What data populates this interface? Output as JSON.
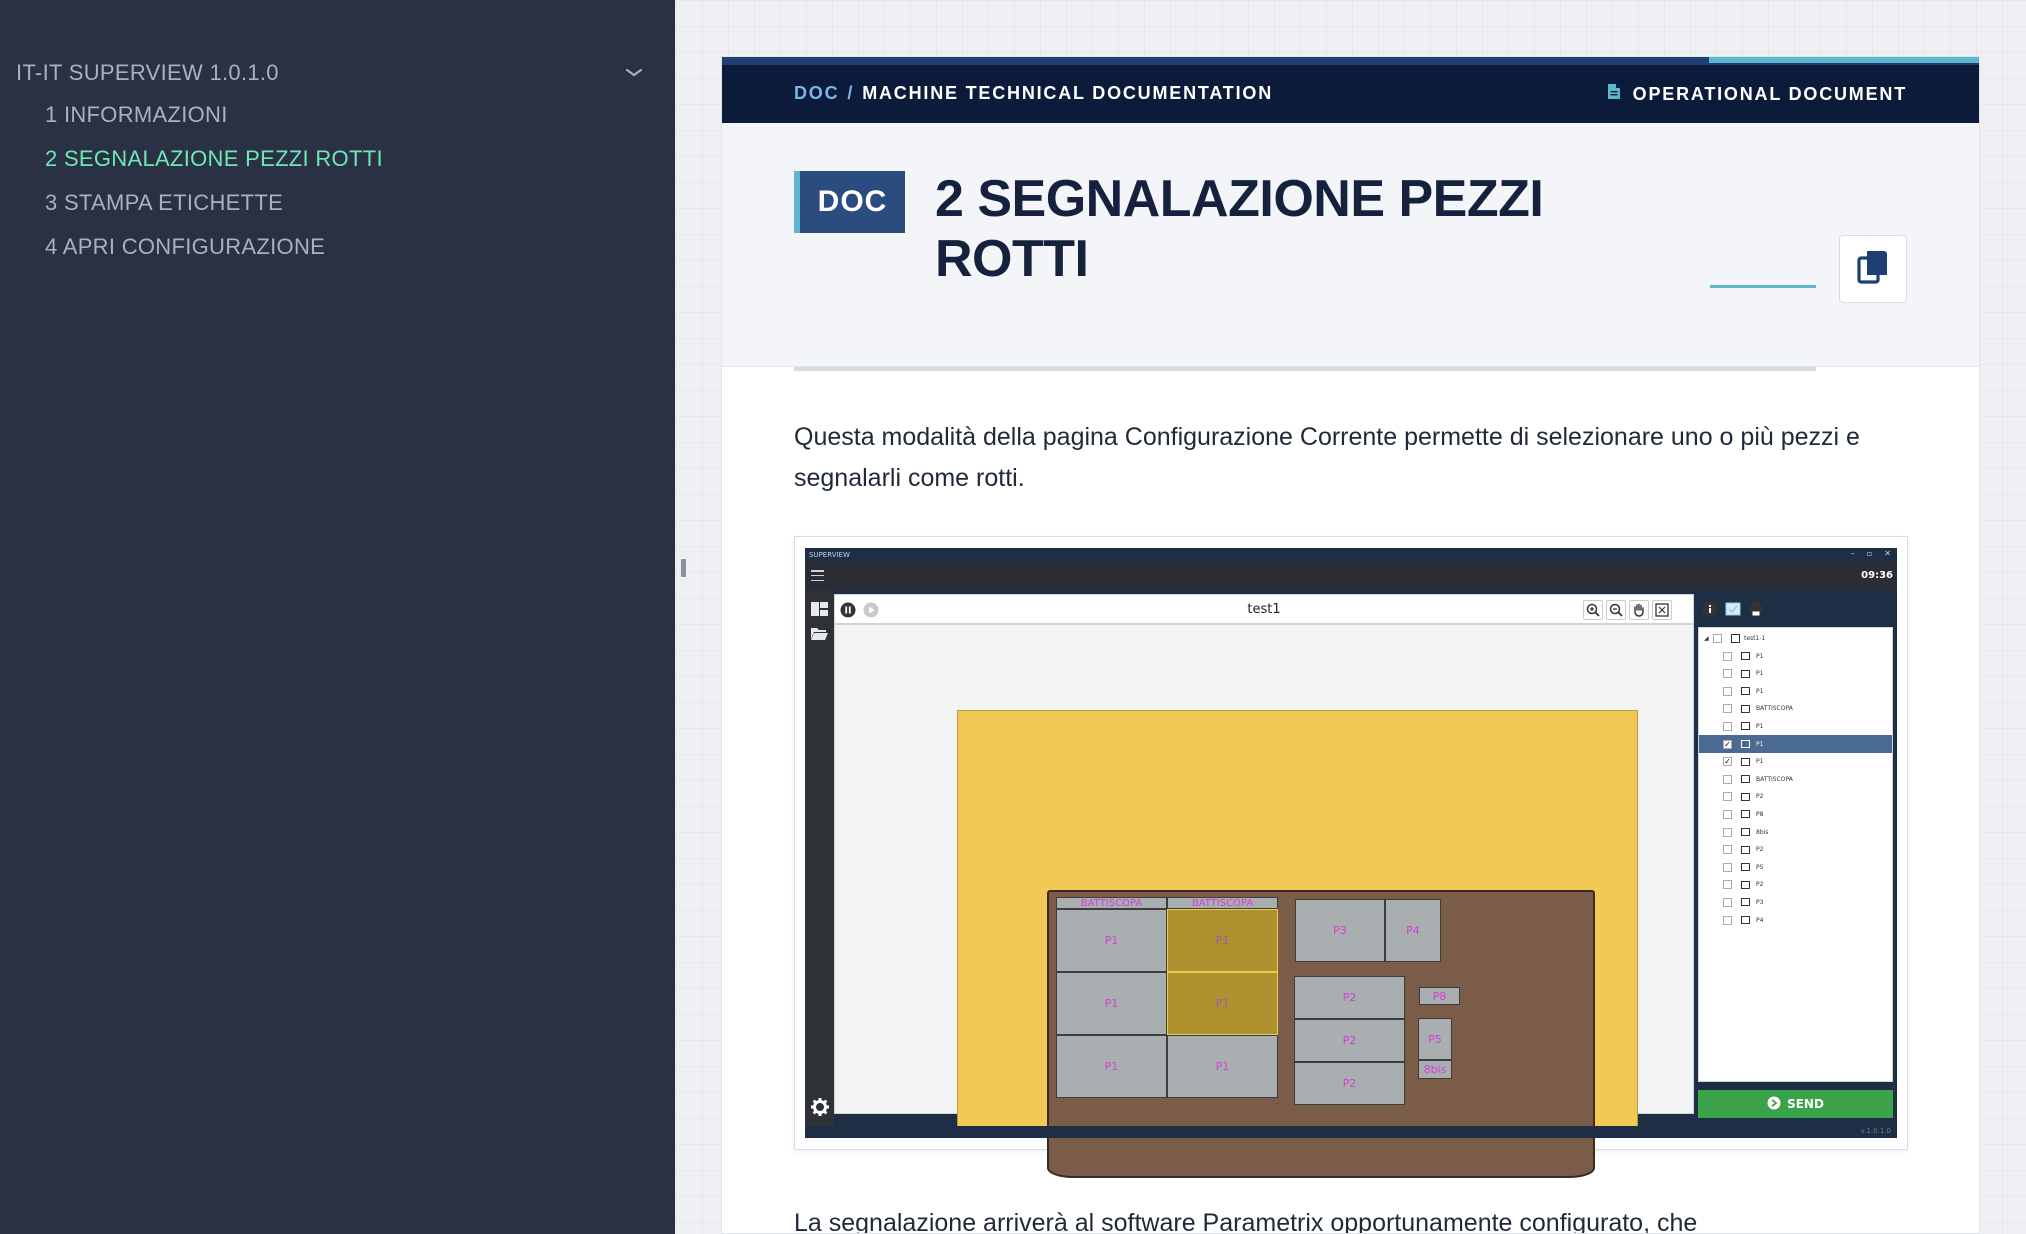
{
  "sidebar": {
    "root_label": "IT-IT SUPERVIEW 1.0.1.0",
    "items": [
      {
        "label": "1 INFORMAZIONI",
        "active": false
      },
      {
        "label": "2 SEGNALAZIONE PEZZI ROTTI",
        "active": true
      },
      {
        "label": "3 STAMPA ETICHETTE",
        "active": false
      },
      {
        "label": "4 APRI CONFIGURAZIONE",
        "active": false
      }
    ]
  },
  "topbar": {
    "breadcrumb_root": "DOC",
    "breadcrumb_sep": "/",
    "breadcrumb_current": "MACHINE TECHNICAL DOCUMENTATION",
    "doc_type": "OPERATIONAL DOCUMENT"
  },
  "header": {
    "badge": "DOC",
    "title": "2 SEGNALAZIONE PEZZI ROTTI"
  },
  "content": {
    "intro": "Questa modalità della pagina Configurazione Corrente permette di selezionare uno o più pezzi e segnalarli come rotti.",
    "outro": "La segnalazione arriverà al software Parametrix opportunamente configurato, che"
  },
  "app_screenshot": {
    "window_title": "SUPERVIEW",
    "window_controls": [
      "–",
      "▫",
      "✕"
    ],
    "clock": "09:36",
    "toolbar_title": "test1",
    "pieces": {
      "battiscopa": "BATTISCOPA",
      "p1": "P1",
      "p2": "P2",
      "p3": "P3",
      "p4": "P4",
      "p5": "P5",
      "p8": "P8",
      "p8bis": "8bis"
    },
    "tree": {
      "root": "test1-1",
      "rows": [
        {
          "label": "P1",
          "checked": false,
          "selected": false
        },
        {
          "label": "P1",
          "checked": false,
          "selected": false
        },
        {
          "label": "P1",
          "checked": false,
          "selected": false
        },
        {
          "label": "BATTISCOPA",
          "checked": false,
          "selected": false
        },
        {
          "label": "P1",
          "checked": false,
          "selected": false
        },
        {
          "label": "P1",
          "checked": true,
          "selected": true
        },
        {
          "label": "P1",
          "checked": true,
          "selected": false
        },
        {
          "label": "BATTISCOPA",
          "checked": false,
          "selected": false
        },
        {
          "label": "P2",
          "checked": false,
          "selected": false
        },
        {
          "label": "P8",
          "checked": false,
          "selected": false
        },
        {
          "label": "8bis",
          "checked": false,
          "selected": false
        },
        {
          "label": "P2",
          "checked": false,
          "selected": false
        },
        {
          "label": "P5",
          "checked": false,
          "selected": false
        },
        {
          "label": "P2",
          "checked": false,
          "selected": false
        },
        {
          "label": "P3",
          "checked": false,
          "selected": false
        },
        {
          "label": "P4",
          "checked": false,
          "selected": false
        }
      ]
    },
    "send_label": "SEND",
    "version": "v.1.0.1.0"
  },
  "colors": {
    "sidebar_bg": "#2b3144",
    "sidebar_active": "#6ee7b7",
    "topbar_bg": "#0d1b3a",
    "accent": "#5fb6d0",
    "badge_bg": "#2b4c7e",
    "title": "#16213e",
    "send_green": "#3aa34a"
  }
}
